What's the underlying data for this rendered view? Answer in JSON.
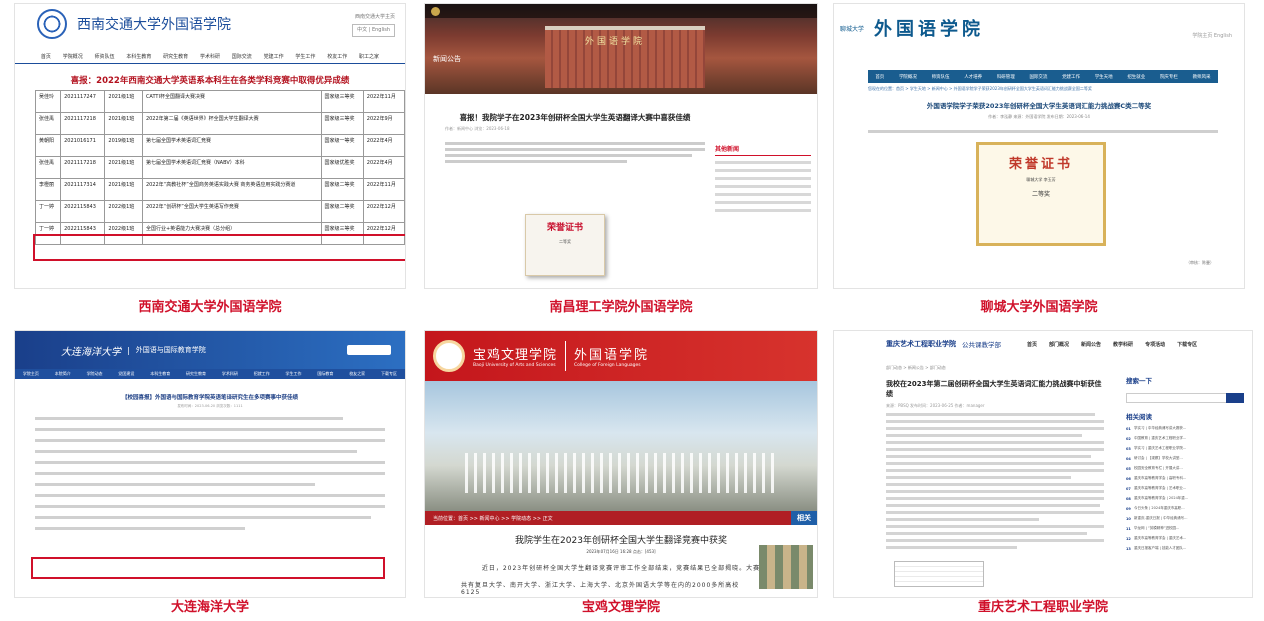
{
  "tiles": {
    "swjtu": {
      "caption": "西南交通大学外国语学院",
      "site_name": "西南交通大学外国语学院",
      "top_right_line1": "西南交通大学主页",
      "top_right_line2": "中文 | English",
      "nav": [
        "首页",
        "学院概况",
        "师资队伍",
        "本科生教育",
        "研究生教育",
        "学术科研",
        "国际交流",
        "党建工作",
        "学生工作",
        "校友工作",
        "职工之家"
      ],
      "headline": "喜报：2022年西南交通大学英语系本科生在各类学科竞赛中取得优异成绩",
      "rows": [
        [
          "吴佳玲",
          "2021117247",
          "2021级1班",
          "CATTI杯全国翻译大赛决赛",
          "国家级三等奖",
          "2022年11月"
        ],
        [
          "张佳禹",
          "2021117218",
          "2021级1班",
          "2022年第二届《英语世界》杯全国大学生翻译大赛",
          "国家级三等奖",
          "2022年9月"
        ],
        [
          "黄朝阳",
          "2021016171",
          "2019级1班",
          "第七届全国学术英语词汇竞赛",
          "国家级一等奖",
          "2022年4月"
        ],
        [
          "张佳禹",
          "2021117218",
          "2021级1班",
          "第七届全国学术英语词汇竞赛（NABV）本科",
          "国家级优胜奖",
          "2022年4月"
        ],
        [
          "李橙丽",
          "2021117314",
          "2021级1班",
          "2022年“高教社杯”全国商务英语实践大赛 商务英语应用实践分赛道",
          "国家级二等奖",
          "2022年11月"
        ],
        [
          "丁一婷",
          "2022115843",
          "2022级1班",
          "2022年“创研杯”全国大学生英语写作竞赛",
          "国家级二等奖",
          "2022年12月"
        ],
        [
          "丁一婷",
          "2022115843",
          "2022级1班",
          "全国行业+英语能力大赛决赛（总分组）",
          "国家级三等奖",
          "2022年12月"
        ]
      ]
    },
    "nanchang": {
      "caption": "南昌理工学院外国语学院",
      "banner_label": "新闻公告",
      "gate_text": "外国语学院",
      "headline": "喜报！我院学子在2023年创研杯全国大学生英语翻译大赛中喜获佳绩",
      "meta": "作者：新闻中心    浏览：2023-06-18",
      "cert_title": "荣誉证书",
      "cert_award": "二等奖",
      "side_heading": "其他新闻"
    },
    "liaocheng": {
      "caption": "聊城大学外国语学院",
      "seal_text": "聊城大学",
      "site_name": "外国语学院",
      "top_right": "学院主页   English",
      "nav": [
        "首页",
        "学院概况",
        "师资队伍",
        "人才培养",
        "科研管理",
        "国际交流",
        "党建工作",
        "学生天地",
        "招生就业",
        "院庆专栏",
        "教师风采"
      ],
      "crumb": "您现在的位置：首页 > 学生天地 > 新闻中心 > 外国语学院学子荣获2023年创研杯全国大学生英语词汇能力挑战赛全国二等奖",
      "headline": "外国语学院学子荣获2023年创研杯全国大学生英语词汇能力挑战赛C类二等奖",
      "meta": "作者：李泓静   来源：外国语学院   发布日期：2023-06-14",
      "cert_title": "荣誉证书",
      "cert_line": "聊城大学 李玉芳",
      "cert_award": "二等奖",
      "footer": "（审核：陈曼）"
    },
    "dalian": {
      "caption": "大连海洋大学",
      "logo_text": "大连海洋大学",
      "dept": "外国语与国际教育学院",
      "nav": [
        "学院主页",
        "本院简介",
        "学院动态",
        "党团建设",
        "本科生教育",
        "研究生教育",
        "学术科研",
        "招就工作",
        "学生工作",
        "国际教育",
        "校友之家",
        "下载专区"
      ],
      "headline": "【校园喜报】外国语与国际教育学院英语笔译研究生在多项赛事中获佳绩",
      "meta": "发布时间：2023-06-20   浏览次数：1111"
    },
    "baoji": {
      "caption": "宝鸡文理学院",
      "cn_name": "宝鸡文理学院",
      "en_name": "Baoji University of Arts and Sciences",
      "dept_cn": "外国语学院",
      "dept_en": "College of Foreign Languages",
      "crumb": "当前位置：首页 >> 新闻中心 >> 学院动态 >> 正文",
      "related": "相关",
      "headline": "我院学生在2023年创研杯全国大学生翻译竞赛中获奖",
      "meta": "2023年07月16日 16:28  点击：[453]",
      "body1": "近日，2023年创研杯全国大学生翻译竞赛评审工作全部结束，竞赛结果已全部揭晓。大赛",
      "body2": "共有复旦大学、南开大学、浙江大学、上海大学、北京外国语大学等在内的2000多所高校6125"
    },
    "chongqing": {
      "caption": "重庆艺术工程职业学院",
      "logo_text": "重庆艺术工程职业学院",
      "dept": "公共课教学部",
      "nav": [
        "首页",
        "部门概况",
        "新闻公告",
        "教学科研",
        "专项活动",
        "下载专区"
      ],
      "crumb": "部门动态 > 新闻公告 > 部门动态",
      "headline": "我校在2023年第二届创研杯全国大学生英语词汇能力挑战赛中斩获佳绩",
      "meta": "来源：PBSQ   发布时间：2023-06-25   作者：manager",
      "search_heading": "搜索一下",
      "related_heading": "相关阅读",
      "related": [
        [
          "01",
          "学实习 | 中华经典诵写讲大赛获..."
        ],
        [
          "02",
          "中国教育 | 重庆艺术工程职业学..."
        ],
        [
          "03",
          "学实习 | 重庆艺术工程职业学院..."
        ],
        [
          "04",
          "研讨会 | 【观察】学校大讲堂..."
        ],
        [
          "05",
          "校园安全教育专栏 | 开展大讲..."
        ],
        [
          "06",
          "重庆市高等教育学会 | 高职专科..."
        ],
        [
          "07",
          "重庆市高等教育学会 | 艺术职业..."
        ],
        [
          "08",
          "重庆市高等教育学会 | 2024年重..."
        ],
        [
          "09",
          "今日头条 | 2024年重庆市高职..."
        ],
        [
          "10",
          "新重庆-重庆日报 | 中华经典诵写..."
        ],
        [
          "11",
          "华龙网 | “劳模精神”进校园..."
        ],
        [
          "12",
          "重庆市高等教育学会 | 重庆艺术..."
        ],
        [
          "13",
          "重庆日报客户端 | 技能人才团队..."
        ]
      ]
    }
  }
}
